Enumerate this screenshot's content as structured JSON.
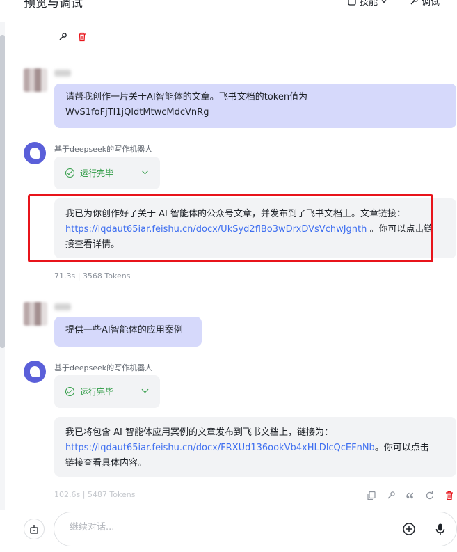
{
  "header": {
    "title": "预览与调试",
    "skills_label": "技能",
    "debug_label": "调试"
  },
  "conversation": {
    "msg1": {
      "role": "user",
      "text_line1": "请帮我创作一片关于AI智能体的文章。飞书文档的token值为",
      "text_line2": "WvS1foFjTl1jQldtMtwcMdcVnRg"
    },
    "reply1": {
      "bot_name": "基于deepseek的写作机器人",
      "status": "运行完毕",
      "text_pre": "我已为你创作好了关于 AI 智能体的公众号文章，并发布到了飞书文档上。文章链接：",
      "link": "https://lqdaut65iar.feishu.cn/docx/UkSyd2flBo3wDrxDVsVchwJgnth",
      "text_mid": " 。你可以点击链",
      "text_post": "接查看详情。",
      "time": "71.3s",
      "tokens": "3568 Tokens"
    },
    "msg2": {
      "role": "user",
      "text": "提供一些AI智能体的应用案例"
    },
    "reply2": {
      "bot_name": "基于deepseek的写作机器人",
      "status": "运行完毕",
      "text_pre": "我已将包含 AI 智能体应用案例的文章发布到飞书文档上，链接为：",
      "link": "https://lqdaut65iar.feishu.cn/docx/FRXUd136ookVb4xHLDlcQcEFnNb",
      "text_mid": "。你可以点击",
      "text_post": "链接查看具体内容。",
      "time": "102.6s",
      "tokens": "5487 Tokens"
    }
  },
  "composer": {
    "placeholder": "继续对话..."
  },
  "colors": {
    "accent": "#5a5fd9",
    "user_bubble": "#d6d9fb",
    "bot_bubble": "#f2f3f5",
    "success": "#2e9b44",
    "link": "#3f6ff0",
    "highlight": "#e8141b"
  }
}
